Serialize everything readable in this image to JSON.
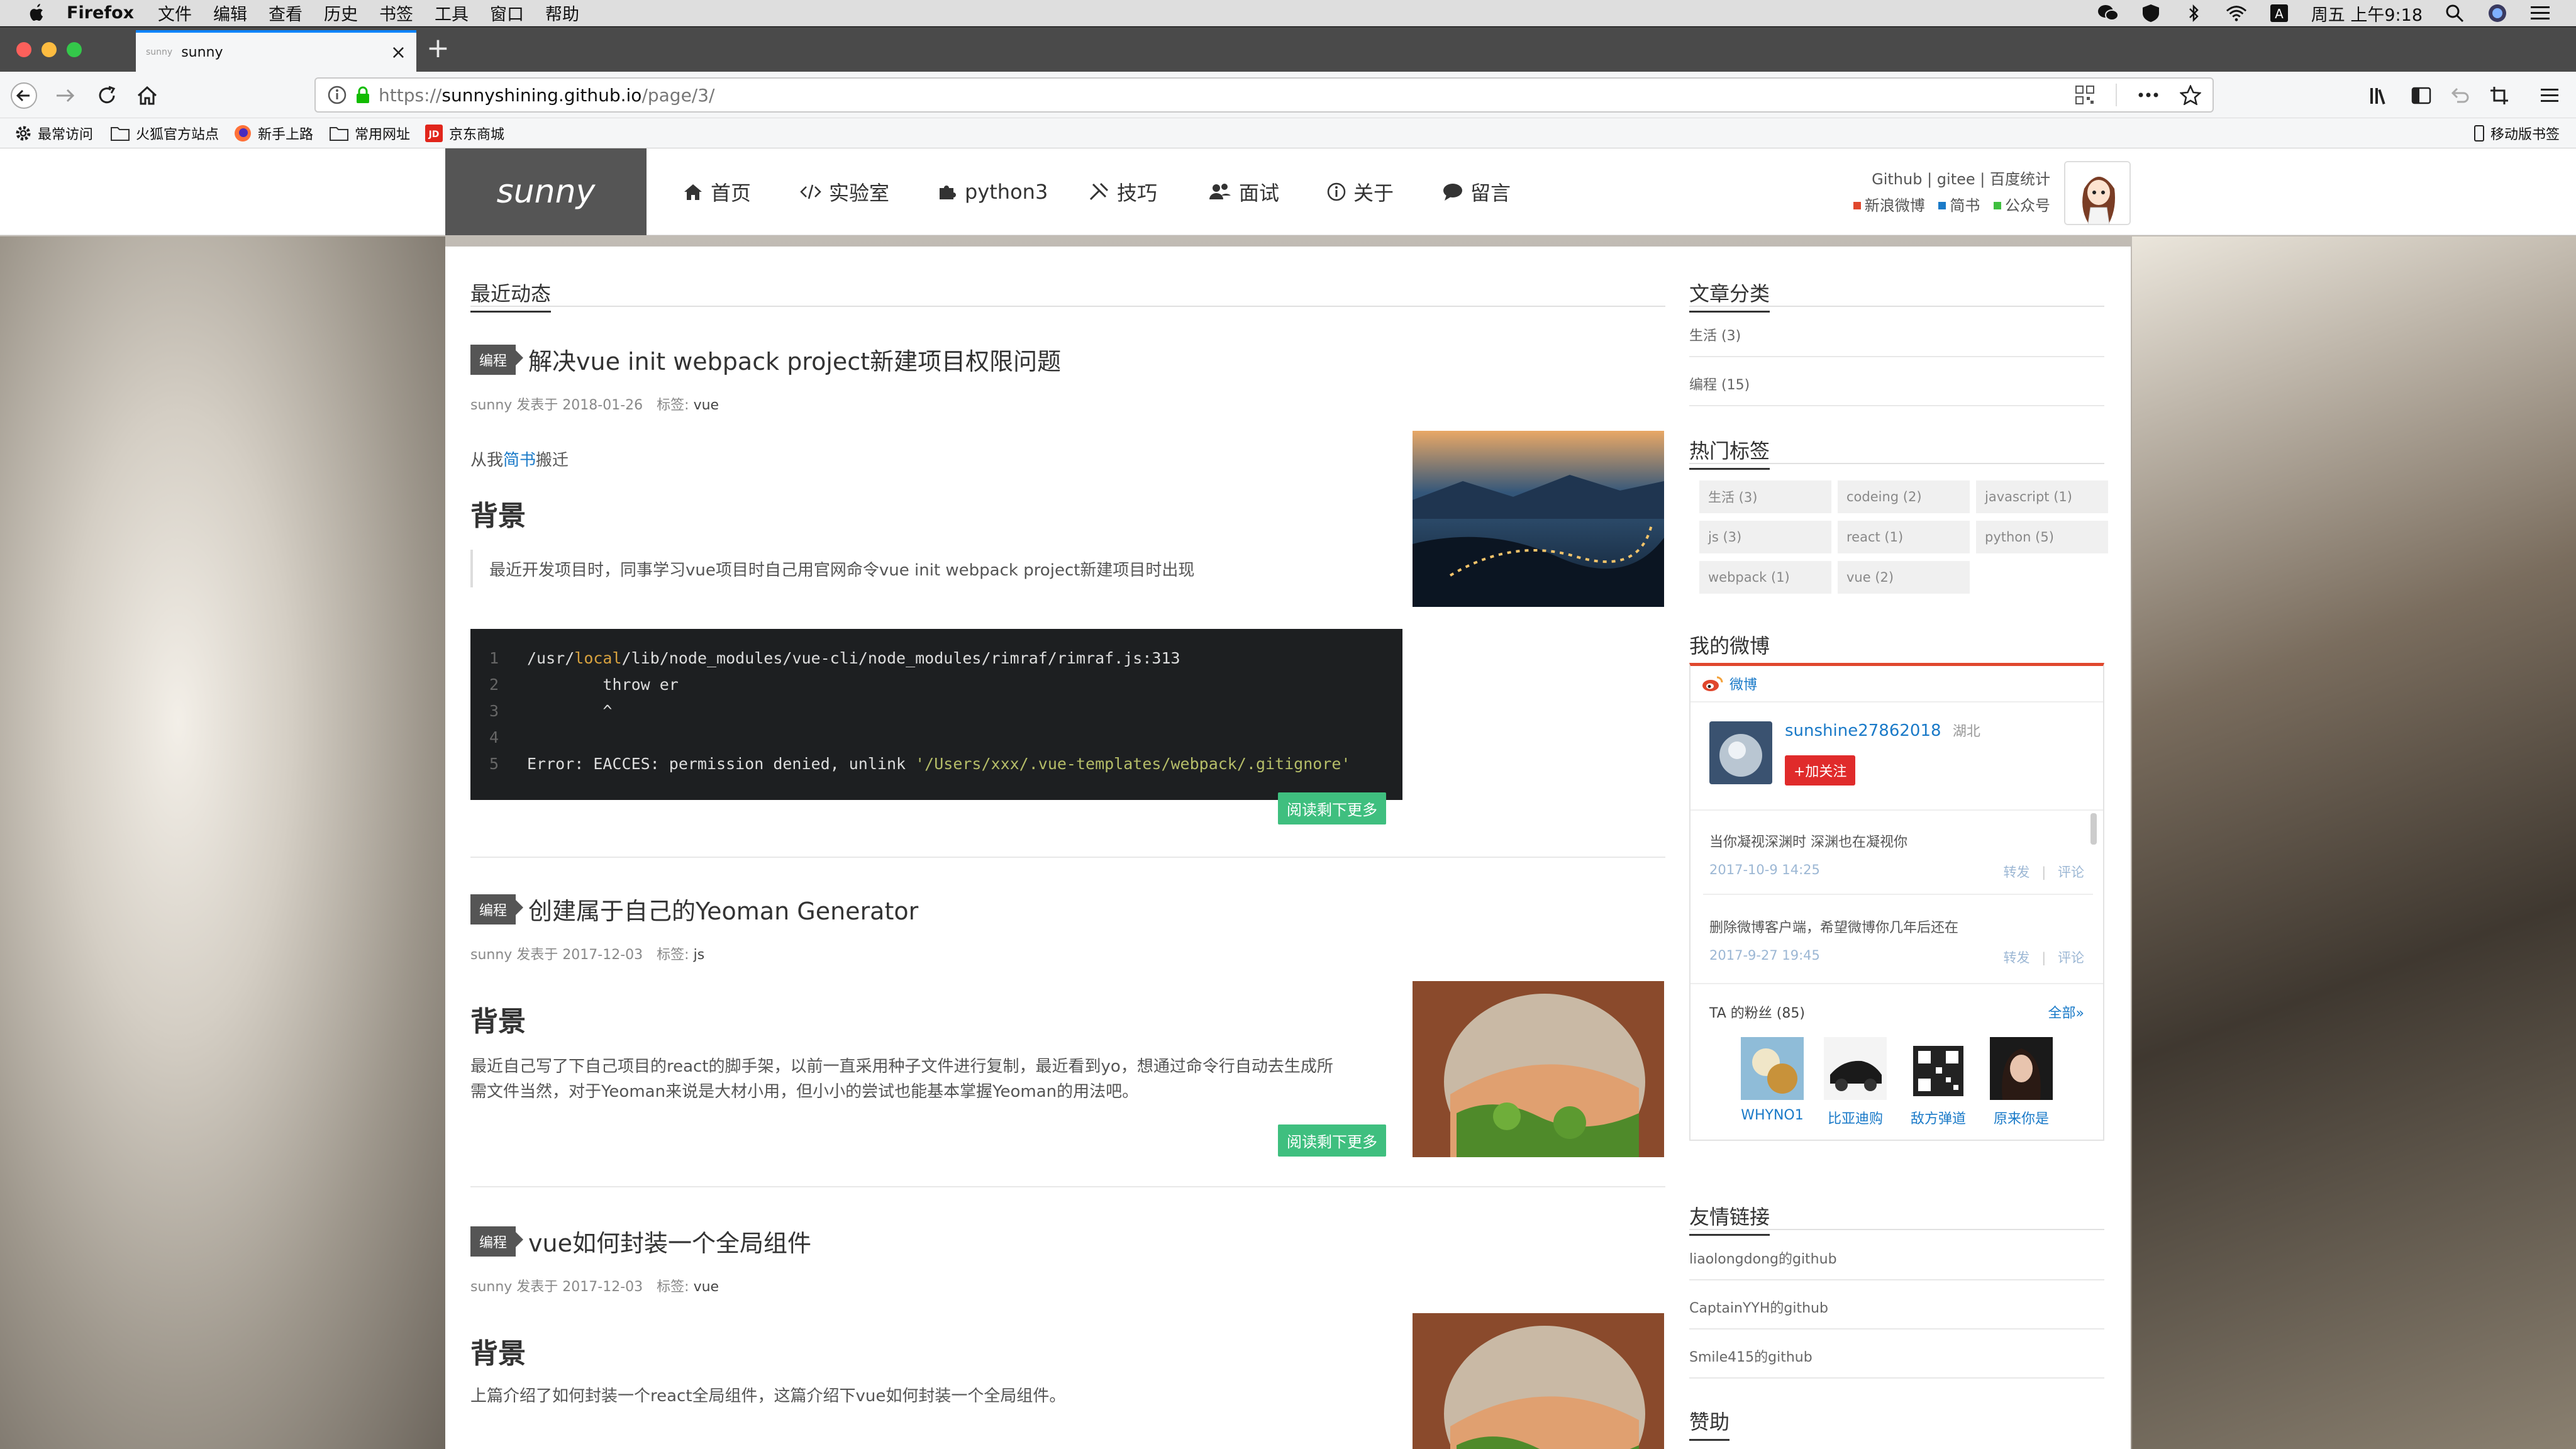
{
  "menubar": {
    "app": "Firefox",
    "items": [
      "文件",
      "编辑",
      "查看",
      "历史",
      "书签",
      "工具",
      "窗口",
      "帮助"
    ],
    "clock": "周五 上午9:18"
  },
  "tab": {
    "title": "sunny",
    "favicon_text": "sunny"
  },
  "url": {
    "protocol": "https://",
    "host": "sunnyshining.github.io",
    "path": "/page/3/"
  },
  "bookmarks": [
    {
      "label": "最常访问",
      "icon": "gear-icon"
    },
    {
      "label": "火狐官方站点",
      "icon": "folder-icon"
    },
    {
      "label": "新手上路",
      "icon": "firefox-icon"
    },
    {
      "label": "常用网址",
      "icon": "folder-icon"
    },
    {
      "label": "京东商城",
      "icon": "jd-icon"
    }
  ],
  "mobile_bookmarks": "移动版书签",
  "site": {
    "logo": "sunny",
    "nav": [
      {
        "label": "首页",
        "icon": "home-icon"
      },
      {
        "label": "实验室",
        "icon": "code-icon"
      },
      {
        "label": "python3",
        "icon": "puzzle-icon"
      },
      {
        "label": "技巧",
        "icon": "tools-icon"
      },
      {
        "label": "面试",
        "icon": "users-icon"
      },
      {
        "label": "关于",
        "icon": "info-icon"
      },
      {
        "label": "留言",
        "icon": "chat-icon"
      }
    ],
    "header_links_line1": "Github | gitee | 百度统计",
    "header_links_line2": [
      {
        "label": "新浪微博",
        "color": "#e0472d"
      },
      {
        "label": "简书",
        "color": "#1a7ac8"
      },
      {
        "label": "公众号",
        "color": "#3fbf3f"
      }
    ]
  },
  "main": {
    "section_title": "最近动态",
    "articles": [
      {
        "category": "编程",
        "title": "解决vue init webpack project新建项目权限问题",
        "meta_prefix": "sunny 发表于 2018-01-26　标签:",
        "tag": "vue",
        "intro_before": "从我",
        "intro_link": "简书",
        "intro_after": "搬迁",
        "heading": "背景",
        "quote": "最近开发项目时，同事学习vue项目时自己用官网命令vue init webpack project新建项目时出现",
        "code": [
          {
            "n": "1",
            "a": "/usr/",
            "b": "local",
            "c": "/lib/node_modules/vue-cli/node_modules/rimraf/rimraf.js:313"
          },
          {
            "n": "2",
            "a": "        throw er",
            "b": "",
            "c": ""
          },
          {
            "n": "3",
            "a": "        ^",
            "b": "",
            "c": ""
          },
          {
            "n": "4",
            "a": "",
            "b": "",
            "c": ""
          },
          {
            "n": "5",
            "a": "Error: EACCES: permission denied, unlink ",
            "b": "",
            "c": "'/Users/xxx/.vue-templates/webpack/.gitignore'"
          }
        ],
        "more": "阅读剩下更多"
      },
      {
        "category": "编程",
        "title": "创建属于自己的Yeoman Generator",
        "meta_prefix": "sunny 发表于 2017-12-03　标签:",
        "tag": "js",
        "heading": "背景",
        "body": [
          "最近自己写了下自己项目的react的脚手架，以前一直采用种子文件进行复制，最近看到yo，想通过命令行自动去生成所",
          "需文件当然，对于Yeoman来说是大材小用，但小小的尝试也能基本掌握Yeoman的用法吧。"
        ],
        "more": "阅读剩下更多"
      },
      {
        "category": "编程",
        "title": "vue如何封装一个全局组件",
        "meta_prefix": "sunny 发表于 2017-12-03　标签:",
        "tag": "vue",
        "heading": "背景",
        "body": [
          "上篇介绍了如何封装一个react全局组件，这篇介绍下vue如何封装一个全局组件。"
        ]
      }
    ]
  },
  "sidebar": {
    "categories_title": "文章分类",
    "categories": [
      "生活 (3)",
      "编程 (15)"
    ],
    "tags_title": "热门标签",
    "tags": [
      "生活 (3)",
      "codeing (2)",
      "javascript (1)",
      "js (3)",
      "react (1)",
      "python (5)",
      "webpack (1)",
      "vue (2)"
    ],
    "weibo_title": "我的微博",
    "weibo": {
      "brand": "微博",
      "user": "sunshine27862018",
      "location": "湖北",
      "follow": "+加关注",
      "posts": [
        {
          "text": "当你凝视深渊时 深渊也在凝视你",
          "time": "2017-10-9 14:25"
        },
        {
          "text": "删除微博客户端，希望微博你几年后还在",
          "time": "2017-9-27 19:45"
        }
      ],
      "repost": "转发",
      "sep": "|",
      "comment": "评论",
      "fans_label": "TA 的粉丝",
      "fans_count": "(85)",
      "all": "全部»",
      "fans": [
        "WHYNO1",
        "比亚迪购",
        "敌方弹道",
        "原来你是"
      ]
    },
    "links_title": "友情链接",
    "links": [
      "liaolongdong的github",
      "CaptainYYH的github",
      "Smile415的github"
    ],
    "donate_title": "赞助"
  }
}
